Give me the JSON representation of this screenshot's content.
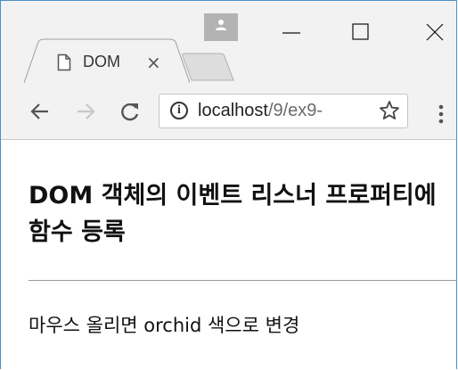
{
  "browser": {
    "tab": {
      "title": "DOM",
      "close_glyph": "×"
    },
    "address_bar": {
      "host": "localhost",
      "path": "/9/ex9-"
    },
    "icons": {
      "profile": "person-icon",
      "minimize": "minimize-icon",
      "maximize": "maximize-icon",
      "close": "close-icon",
      "tab_page": "page-icon",
      "back": "arrow-left-icon",
      "forward": "arrow-right-icon",
      "reload": "reload-icon",
      "site_info": "info-icon",
      "bookmark": "star-icon",
      "menu": "kebab-menu-icon"
    },
    "colors": {
      "window_border": "#4a90c8",
      "chrome_bg": "#f2f2f2",
      "profile_badge": "#b3b3b3"
    }
  },
  "page": {
    "heading": "DOM 객체의 이벤트 리스너 프로퍼티에 함수 등록",
    "text": "마우스 올리면 orchid 색으로 변경"
  }
}
